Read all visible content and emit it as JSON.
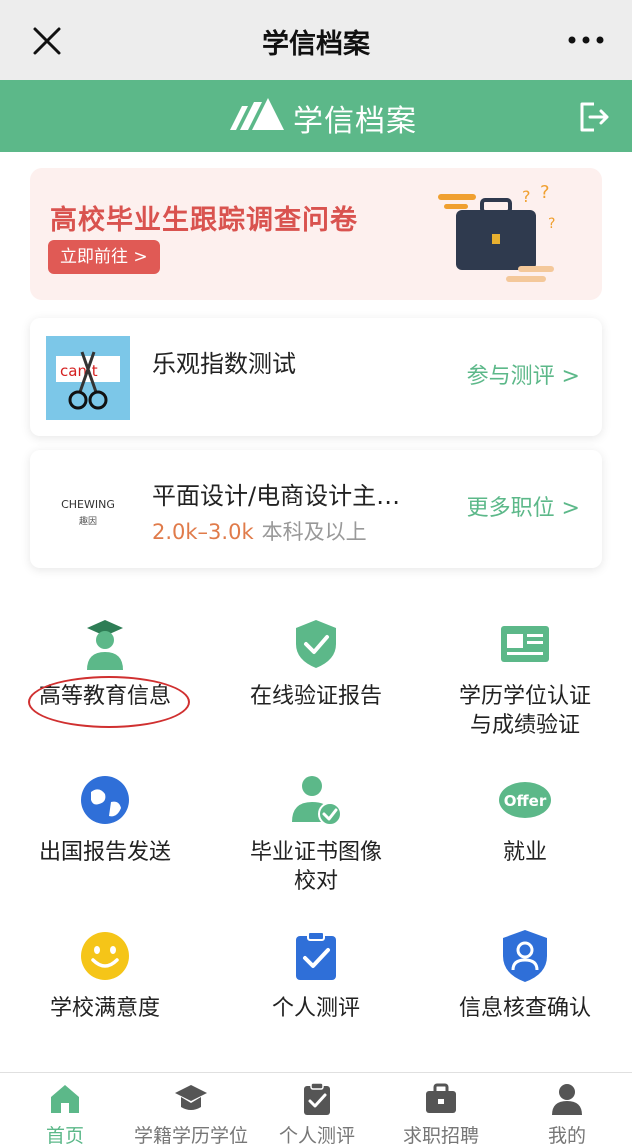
{
  "topbar": {
    "title": "学信档案"
  },
  "brand": {
    "name": "学信档案"
  },
  "banner": {
    "title": "高校毕业生跟踪调查问卷",
    "button": "立即前往 >"
  },
  "cards": [
    {
      "title": "乐观指数测试",
      "action": "参与测评 >",
      "thumb_text": "can t"
    },
    {
      "title": "平面设计/电商设计主…",
      "salary": "2.0k–3.0k",
      "education": "本科及以上",
      "action": "更多职位 >",
      "logo_text": "CHEWING",
      "logo_sub": "趣因"
    }
  ],
  "grid": [
    {
      "label": "高等教育信息",
      "icon": "graduate-icon"
    },
    {
      "label": "在线验证报告",
      "icon": "shield-check-icon"
    },
    {
      "label": "学历学位认证\n与成绩验证",
      "icon": "id-card-icon"
    },
    {
      "label": "出国报告发送",
      "icon": "globe-icon"
    },
    {
      "label": "毕业证书图像\n校对",
      "icon": "user-check-icon"
    },
    {
      "label": "就业",
      "icon": "offer-icon"
    },
    {
      "label": "学校满意度",
      "icon": "smile-icon"
    },
    {
      "label": "个人测评",
      "icon": "clipboard-check-icon"
    },
    {
      "label": "信息核查确认",
      "icon": "user-shield-icon"
    }
  ],
  "tabs": [
    {
      "label": "首页",
      "icon": "home-icon",
      "active": true
    },
    {
      "label": "学籍学历学位",
      "icon": "grad-cap-icon"
    },
    {
      "label": "个人测评",
      "icon": "clipboard-icon"
    },
    {
      "label": "求职招聘",
      "icon": "briefcase-icon"
    },
    {
      "label": "我的",
      "icon": "person-icon"
    }
  ],
  "colors": {
    "brand_green": "#5cb889",
    "banner_red": "#d9534f",
    "salary_orange": "#e07b4a",
    "highlight_ring": "#d03030"
  }
}
